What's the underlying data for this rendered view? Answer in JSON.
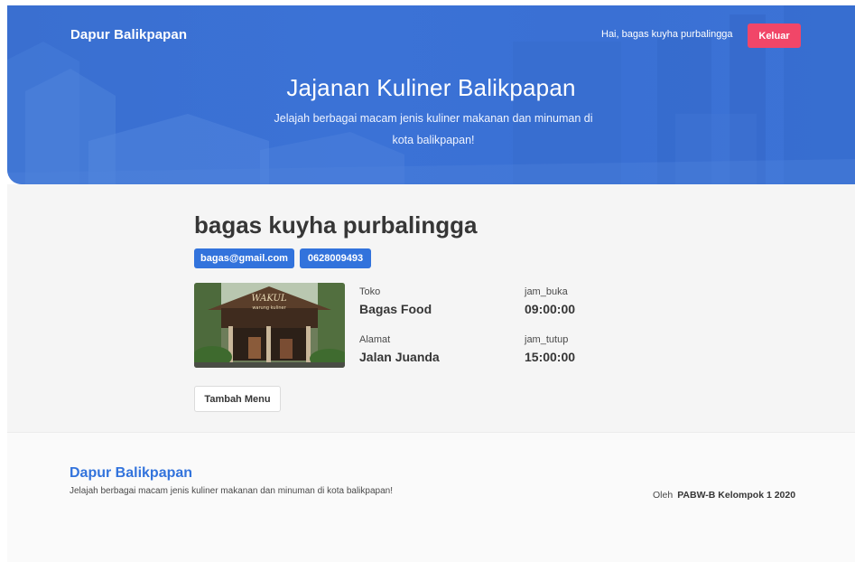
{
  "header": {
    "brand": "Dapur Balikpapan",
    "greeting": "Hai, bagas kuyha purbalingga",
    "logout_label": "Keluar"
  },
  "hero": {
    "title": "Jajanan Kuliner Balikpapan",
    "subtitle_line1": "Jelajah berbagai macam jenis kuliner makanan dan minuman di",
    "subtitle_line2": "kota balikpapan!"
  },
  "profile": {
    "name": "bagas kuyha purbalingga",
    "email": "bagas@gmail.com",
    "phone": "0628009493",
    "photo_sign": "WAKUL",
    "photo_subsign": "warung kuliner",
    "fields": {
      "toko_label": "Toko",
      "toko_value": "Bagas Food",
      "alamat_label": "Alamat",
      "alamat_value": "Jalan Juanda",
      "jam_buka_label": "jam_buka",
      "jam_buka_value": "09:00:00",
      "jam_tutup_label": "jam_tutup",
      "jam_tutup_value": "15:00:00"
    },
    "add_menu_label": "Tambah Menu"
  },
  "footer": {
    "brand": "Dapur Balikpapan",
    "description": "Jelajah berbagai macam jenis kuliner makanan dan minuman di kota balikpapan!",
    "credit_prefix": "Oleh",
    "credit_name": "PABW-B Kelompok 1 2020"
  },
  "colors": {
    "hero_blue": "#3a70d4",
    "primary": "#3273dc",
    "danger": "#f14668",
    "main_bg": "#f5f5f5",
    "footer_bg": "#fafafa"
  }
}
